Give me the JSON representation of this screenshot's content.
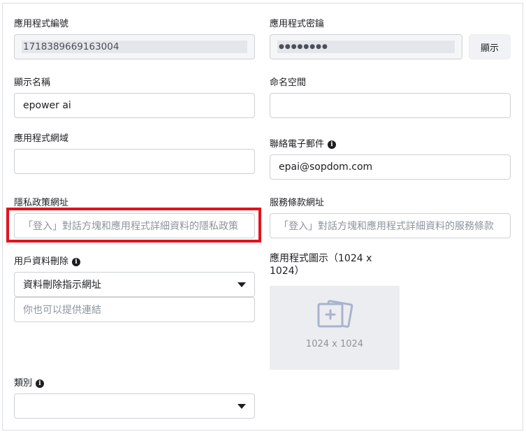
{
  "app_id": {
    "label": "應用程式編號",
    "value": "1718389669163004"
  },
  "app_secret": {
    "label": "應用程式密鑰",
    "value": "●●●●●●●●",
    "show_button": "顯示"
  },
  "display_name": {
    "label": "顯示名稱",
    "value": "epower ai"
  },
  "namespace": {
    "label": "命名空間",
    "value": ""
  },
  "app_domains": {
    "label": "應用程式網域",
    "value": ""
  },
  "contact_email": {
    "label": "聯絡電子郵件",
    "value": "epai@sopdom.com",
    "info_icon": "info-icon"
  },
  "privacy_url": {
    "label": "隱私政策網址",
    "placeholder": "「登入」對話方塊和應用程式詳細資料的隱私政策"
  },
  "terms_url": {
    "label": "服務條款網址",
    "placeholder": "「登入」對話方塊和應用程式詳細資料的服務條款"
  },
  "data_deletion": {
    "label": "用戶資料刪除",
    "info_icon": "info-icon",
    "selected": "資料刪除指示網址",
    "placeholder": "你也可以提供連結"
  },
  "app_icon": {
    "label_line1": "應用程式圖示（1024 x",
    "label_line2": "1024）",
    "size_text": "1024 x 1024",
    "icon": "image-add-icon"
  },
  "category": {
    "label": "類別",
    "info_icon": "info-icon",
    "selected": ""
  },
  "colors": {
    "highlight": "#e0141e",
    "border": "#ccd0d5",
    "placeholder": "#8d949e"
  }
}
